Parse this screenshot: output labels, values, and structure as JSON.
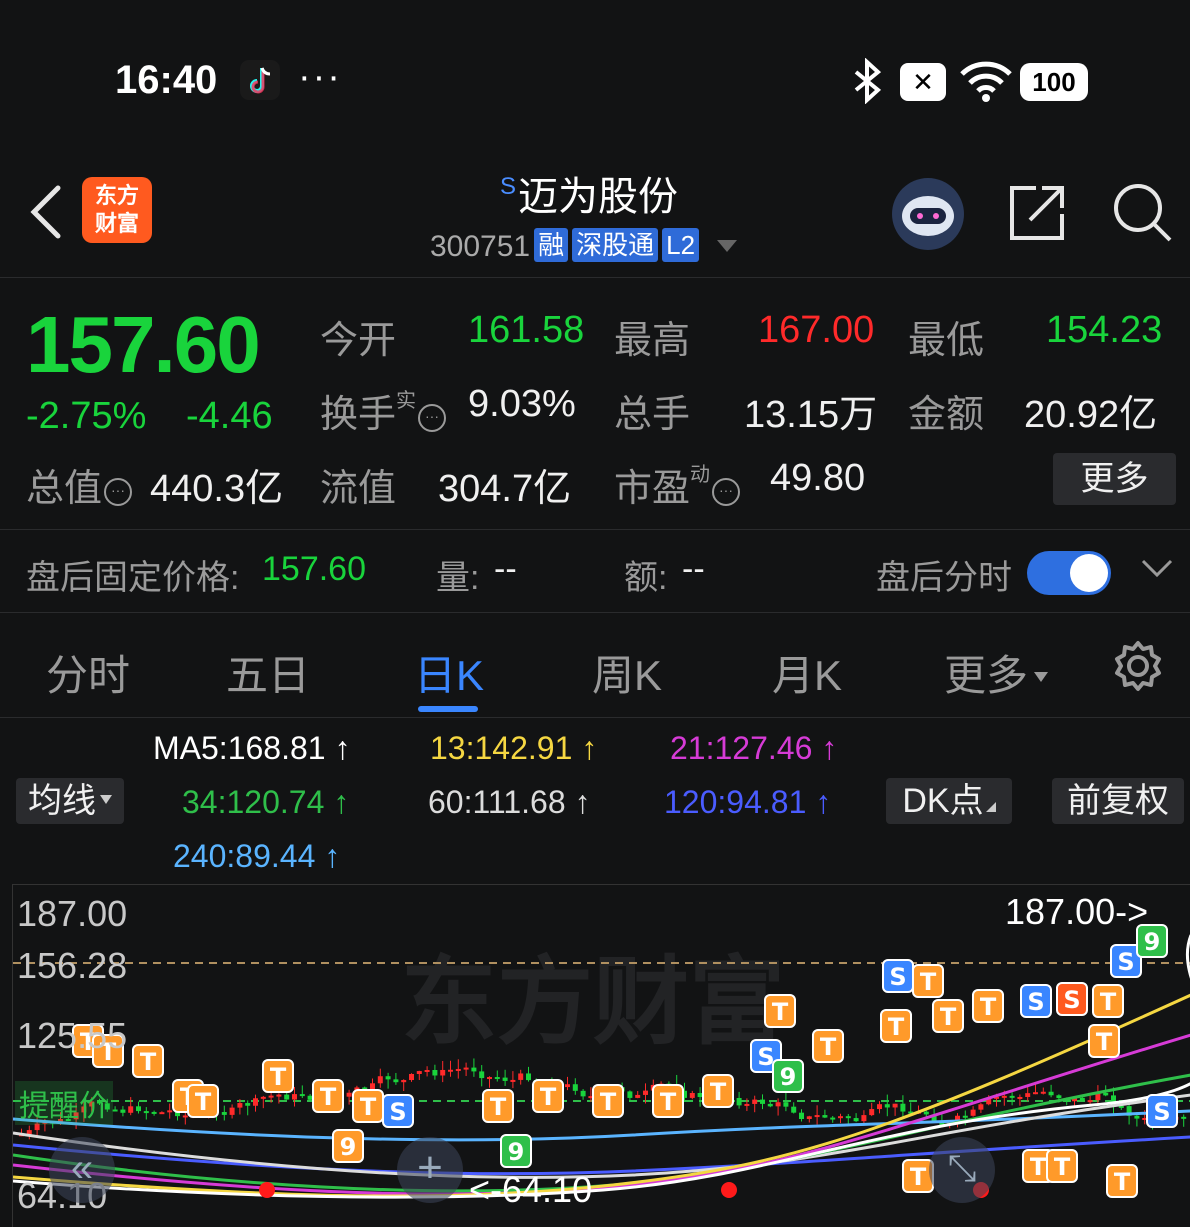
{
  "status_bar": {
    "time": "16:40",
    "more": "···",
    "battery": "100",
    "icons": [
      "tiktok-icon",
      "bluetooth-icon",
      "no-sim-icon",
      "wifi-icon",
      "battery-icon"
    ]
  },
  "header": {
    "logo_line1": "东方",
    "logo_line2": "财富",
    "title_prefix": "S",
    "title": "迈为股份",
    "code": "300751",
    "tags": [
      "融",
      "深股通",
      "L2"
    ]
  },
  "quote": {
    "price": "157.60",
    "change_pct": "-2.75%",
    "change_abs": "-4.46",
    "open_label": "今开",
    "open": "161.58",
    "high_label": "最高",
    "high": "167.00",
    "low_label": "最低",
    "low": "154.23",
    "turnover_label": "换手",
    "turnover_sup": "实",
    "turnover": "9.03%",
    "volume_label": "总手",
    "volume": "13.15万",
    "amount_label": "金额",
    "amount": "20.92亿",
    "mktcap_label": "总值",
    "mktcap": "440.3亿",
    "float_label": "流值",
    "float": "304.7亿",
    "pe_label": "市盈",
    "pe_sup": "动",
    "pe": "49.80",
    "more": "更多"
  },
  "after_hours": {
    "price_label": "盘后固定价格:",
    "price": "157.60",
    "vol_label": "量:",
    "vol": "--",
    "amt_label": "额:",
    "amt": "--",
    "toggle_label": "盘后分时"
  },
  "tabs": [
    "分时",
    "五日",
    "日K",
    "周K",
    "月K",
    "更多"
  ],
  "active_tab": "日K",
  "ma": {
    "ma5": "MA5:168.81",
    "ma13": "13:142.91",
    "ma21": "21:127.46",
    "ma34": "34:120.74",
    "ma60": "60:111.68",
    "ma120": "120:94.81",
    "ma240": "240:89.44",
    "arrow": "↑",
    "indicator_select": "均线",
    "dk_button": "DK点",
    "adjust_button": "前复权"
  },
  "chart": {
    "y_top": "187.00",
    "y_mid": "156.28",
    "y_low": "125.55",
    "y_bottom": "64.10",
    "high_marker": "187.00->",
    "low_marker": "<-64.10",
    "reminder": "提醒价",
    "watermark": "东方财富",
    "colors": {
      "up": "#ff2a2a",
      "down": "#19d43c",
      "ma5": "#ffffff",
      "ma13": "#f5d742",
      "ma21": "#d63bd6",
      "ma34": "#2fbf4a",
      "ma60": "#dcdcdc",
      "ma120": "#4a5cff",
      "ma240": "#5ab4ff"
    }
  }
}
